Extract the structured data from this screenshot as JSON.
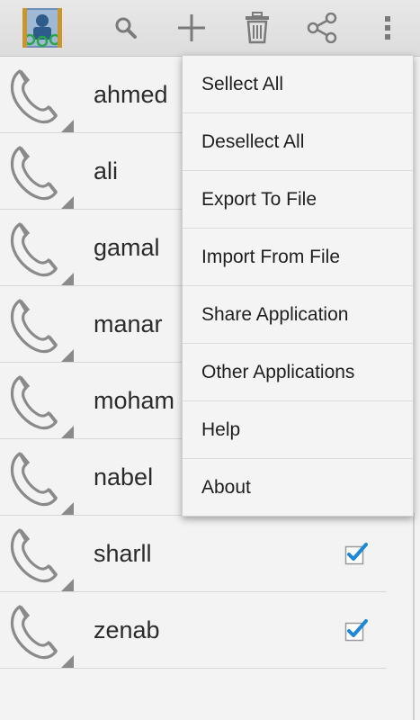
{
  "actionbar": {
    "app_icon": "contact-app-icon",
    "actions": [
      "search-icon",
      "add-icon",
      "delete-icon",
      "share-icon",
      "overflow-menu-icon"
    ]
  },
  "contacts": [
    {
      "name": "ahmed",
      "checked": true
    },
    {
      "name": "ali",
      "checked": true
    },
    {
      "name": "gamal",
      "checked": true
    },
    {
      "name": "manar",
      "checked": true
    },
    {
      "name": "moham",
      "checked": true
    },
    {
      "name": "nabel",
      "checked": true
    },
    {
      "name": "sharll",
      "checked": true
    },
    {
      "name": "zenab",
      "checked": true
    }
  ],
  "menu": {
    "items": [
      "Sellect All",
      "Desellect All",
      "Export To File",
      "Import From File",
      "Share Application",
      "Other Applications",
      "Help",
      "About"
    ]
  },
  "colors": {
    "accent": "#1e88d8",
    "icon_gray": "#8a8a8a"
  }
}
